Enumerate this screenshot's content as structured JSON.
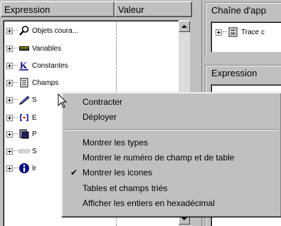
{
  "columns": {
    "expression": "Expression",
    "valeur": "Valeur"
  },
  "tree": {
    "items": [
      {
        "label": "Objets coura...",
        "icon": "search-icon"
      },
      {
        "label": "Variables",
        "icon": "variable-icon"
      },
      {
        "label": "Constantes",
        "icon": "constant-icon"
      },
      {
        "label": "Champs",
        "icon": "field-list-icon"
      },
      {
        "label": "S",
        "icon": "pen-icon"
      },
      {
        "label": "E",
        "icon": "bracket-icon"
      },
      {
        "label": "P",
        "icon": "process-icon"
      },
      {
        "label": "S",
        "icon": "dotted-bar-icon"
      },
      {
        "label": "Ir",
        "icon": "info-icon"
      }
    ]
  },
  "right_panel": {
    "chain_title": "Chaîne d'app",
    "chain_item": "Trace c",
    "expression_title": "Expression"
  },
  "context_menu": {
    "items": [
      {
        "label": "Contracter",
        "checked": false
      },
      {
        "label": "Déployer",
        "checked": false
      },
      {
        "label": "Montrer les types",
        "checked": false
      },
      {
        "label": "Montrer le numéro de champ et de table",
        "checked": false
      },
      {
        "label": "Montrer les icones",
        "checked": true
      },
      {
        "label": "Tables et champs triés",
        "checked": false
      },
      {
        "label": "Afficher les entiers en hexadécimal",
        "checked": false
      }
    ],
    "check_glyph": "✔"
  },
  "colors": {
    "face": "#c0c0c0",
    "window": "#ffffff",
    "shadow": "#808080",
    "info_blue": "#000080"
  }
}
